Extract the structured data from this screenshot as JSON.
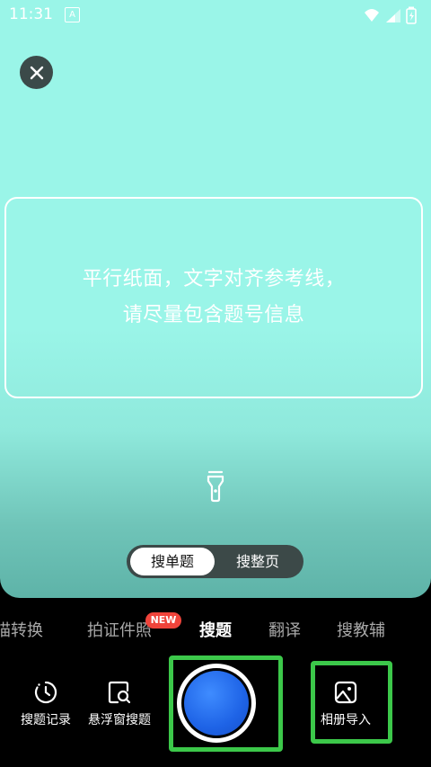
{
  "status_bar": {
    "time": "11:31",
    "app_badge": "A"
  },
  "frame": {
    "hint_line1": "平行纸面，文字对齐参考线，",
    "hint_line2": "请尽量包含题号信息"
  },
  "mode_toggle": {
    "single": "搜单题",
    "page": "搜整页",
    "selected": "搜单题"
  },
  "tabs": [
    "描转换",
    "拍证件照",
    "搜题",
    "翻译",
    "搜教辅"
  ],
  "active_tab": "搜题",
  "new_badge": "NEW",
  "tools": {
    "history": "搜题记录",
    "floating": "悬浮窗搜题",
    "album": "相册导入"
  },
  "colors": {
    "accent": "#1e63e6",
    "highlight": "#3cc84a",
    "badge": "#f0443b",
    "camera_bg": "#9af5e8"
  }
}
